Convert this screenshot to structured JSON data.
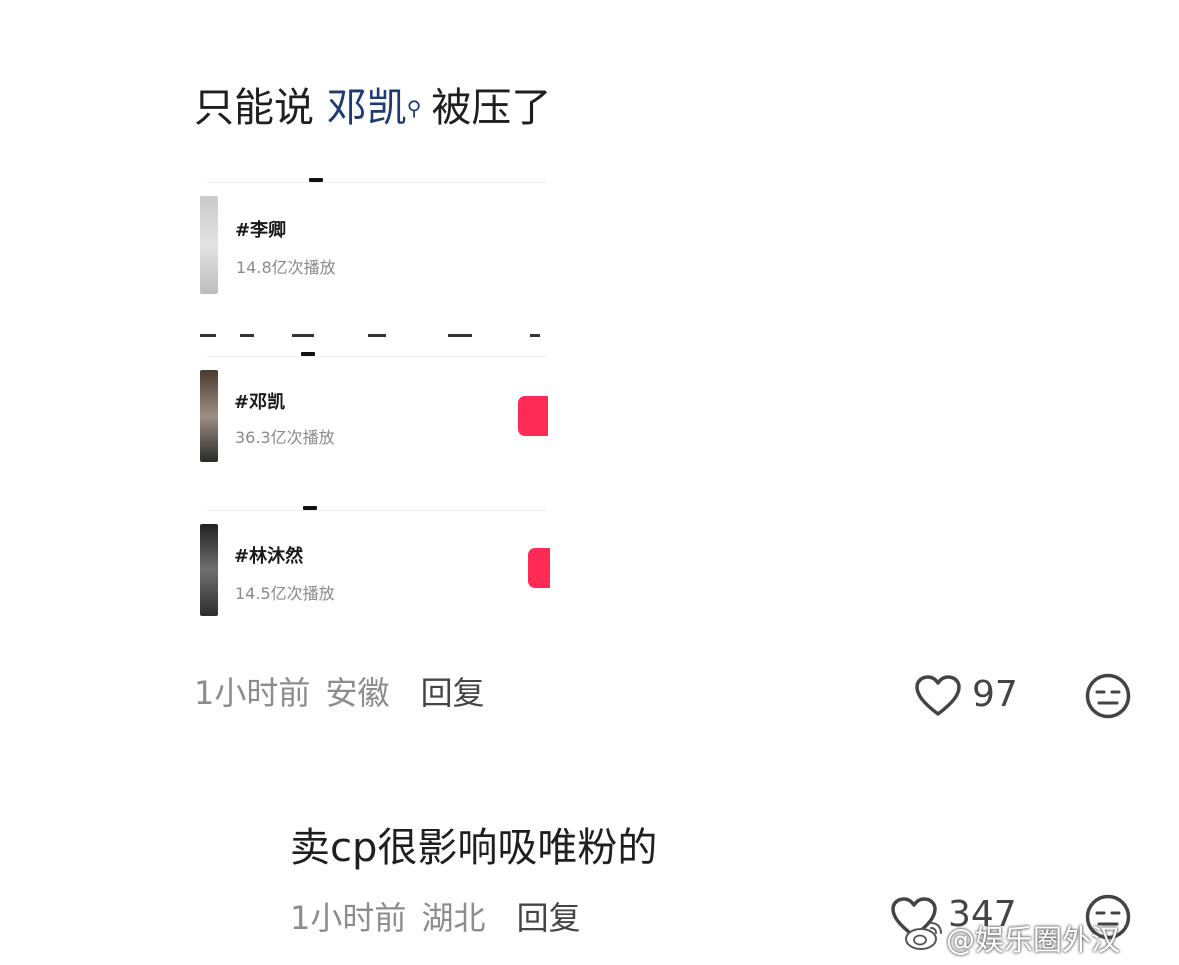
{
  "comment1": {
    "text_before": "只能说 ",
    "mention": "邓凯",
    "text_after": "被压了",
    "time": "1小时前",
    "location": "安徽",
    "reply_label": "回复",
    "likes": "97"
  },
  "topics": [
    {
      "title": "#李卿",
      "plays": "14.8亿次播放"
    },
    {
      "title": "#邓凯",
      "plays": "36.3亿次播放"
    },
    {
      "title": "#林沐然",
      "plays": "14.5亿次播放"
    }
  ],
  "comment2": {
    "text": "卖cp很影响吸唯粉的",
    "time": "1小时前",
    "location": "湖北",
    "reply_label": "回复",
    "likes": "347"
  },
  "watermark": "@娱乐圈外汉",
  "colors": {
    "accent_pink": "#ff2a55",
    "mention_blue": "#1e3a6e",
    "meta_gray": "#8c8c8c"
  },
  "icons": [
    "search-icon",
    "heart-icon",
    "dislike-face-icon",
    "weibo-logo-icon"
  ]
}
